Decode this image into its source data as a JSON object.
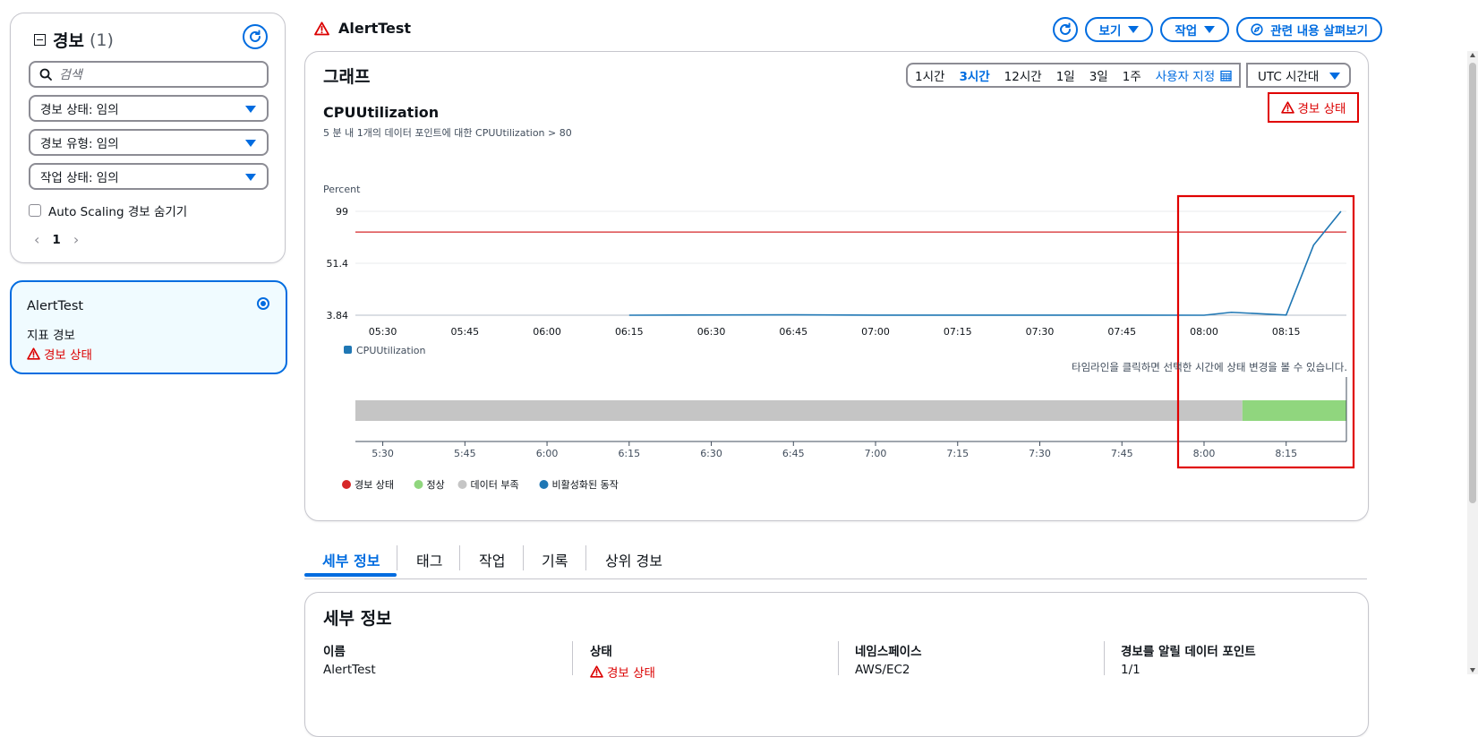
{
  "sidebar": {
    "title": "경보",
    "count": "(1)",
    "search_placeholder": "검색",
    "filters": [
      {
        "label": "경보 상태: 임의"
      },
      {
        "label": "경보 유형: 임의"
      },
      {
        "label": "작업 상태: 임의"
      }
    ],
    "hide_autoscaling": "Auto Scaling 경보 숨기기",
    "page": "1",
    "alarm_card": {
      "name": "AlertTest",
      "type": "지표 경보",
      "state": "경보 상태"
    }
  },
  "header": {
    "title": "AlertTest",
    "view_label": "보기",
    "actions_label": "작업",
    "explore_label": "관련 내용 살펴보기"
  },
  "graph": {
    "title": "그래프",
    "ranges": [
      "1시간",
      "3시간",
      "12시간",
      "1일",
      "3일",
      "1주"
    ],
    "selected_range": "3시간",
    "custom_label": "사용자 지정",
    "timezone": "UTC 시간대",
    "metric_title": "CPUUtilization",
    "metric_desc": "5 분 내 1개의 데이터 포인트에 대한 CPUUtilization > 80",
    "state_label": "경보 상태",
    "timeline_note": "타임라인을 클릭하면 선택한 시간에 상태 변경을 볼 수 있습니다."
  },
  "chart_data": {
    "type": "line",
    "ylabel": "Percent",
    "yticks": [
      "99",
      "51.4",
      "3.84"
    ],
    "ylim": [
      3.84,
      99
    ],
    "x_ticks": [
      "05:30",
      "05:45",
      "06:00",
      "06:15",
      "06:30",
      "06:45",
      "07:00",
      "07:15",
      "07:30",
      "07:45",
      "08:00",
      "08:15"
    ],
    "threshold": 80,
    "series": [
      {
        "name": "CPUUtilization",
        "color": "#1f77b4",
        "x": [
          "06:15",
          "06:45",
          "07:00",
          "07:45",
          "08:00",
          "08:05",
          "08:15",
          "08:20",
          "08:25"
        ],
        "values": [
          3.84,
          4.2,
          3.9,
          3.9,
          3.84,
          6.5,
          4.0,
          68,
          99
        ]
      }
    ],
    "timeline": {
      "ticks": [
        "5:30",
        "5:45",
        "6:00",
        "6:15",
        "6:30",
        "6:45",
        "7:00",
        "7:15",
        "7:30",
        "7:45",
        "8:00",
        "8:15"
      ],
      "segments": [
        {
          "state": "insufficient",
          "from": "5:25",
          "to": "8:07"
        },
        {
          "state": "ok",
          "from": "8:07",
          "to": "8:26"
        }
      ]
    },
    "legend": [
      {
        "label": "경보 상태",
        "color": "#d62728"
      },
      {
        "label": "정상",
        "color": "#90d67e"
      },
      {
        "label": "데이터 부족",
        "color": "#c5c5c5"
      },
      {
        "label": "비활성화된 동작",
        "color": "#1f77b4"
      }
    ]
  },
  "tabs": [
    "세부 정보",
    "태그",
    "작업",
    "기록",
    "상위 경보"
  ],
  "details": {
    "title": "세부 정보",
    "items": [
      {
        "key": "이름",
        "value": "AlertTest"
      },
      {
        "key": "상태",
        "value": "경보 상태"
      },
      {
        "key": "네임스페이스",
        "value": "AWS/EC2"
      },
      {
        "key": "경보를 알릴 데이터 포인트",
        "value": "1/1"
      }
    ]
  }
}
